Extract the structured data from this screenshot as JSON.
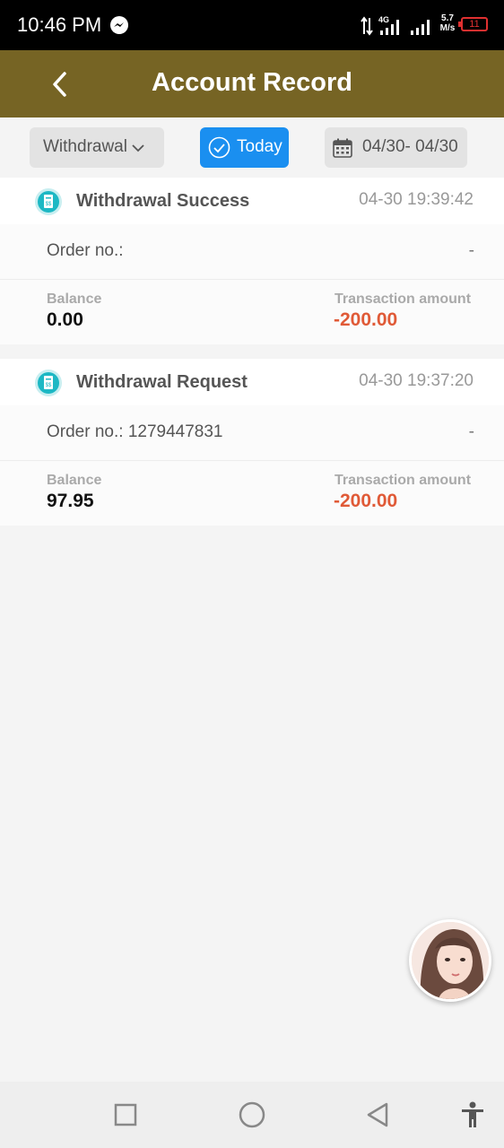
{
  "status_bar": {
    "time": "10:46 PM",
    "network": "4G",
    "speed_value": "5.7",
    "speed_unit": "M/s",
    "battery": "11"
  },
  "header": {
    "title": "Account Record"
  },
  "filters": {
    "type_label": "Withdrawal",
    "today_label": "Today",
    "date_range": "04/30- 04/30"
  },
  "records": [
    {
      "title": "Withdrawal Success",
      "time": "04-30 19:39:42",
      "order": "Order no.:",
      "order_status": "-",
      "balance_label": "Balance",
      "balance": "0.00",
      "amount_label": "Transaction amount",
      "amount": "-200.00"
    },
    {
      "title": "Withdrawal Request",
      "time": "04-30 19:37:20",
      "order": "Order no.: 1279447831",
      "order_status": "-",
      "balance_label": "Balance",
      "balance": "97.95",
      "amount_label": "Transaction amount",
      "amount": "-200.00"
    }
  ],
  "colors": {
    "header_bg": "#766424",
    "accent": "#1a8ff0",
    "negative": "#e05a37"
  }
}
